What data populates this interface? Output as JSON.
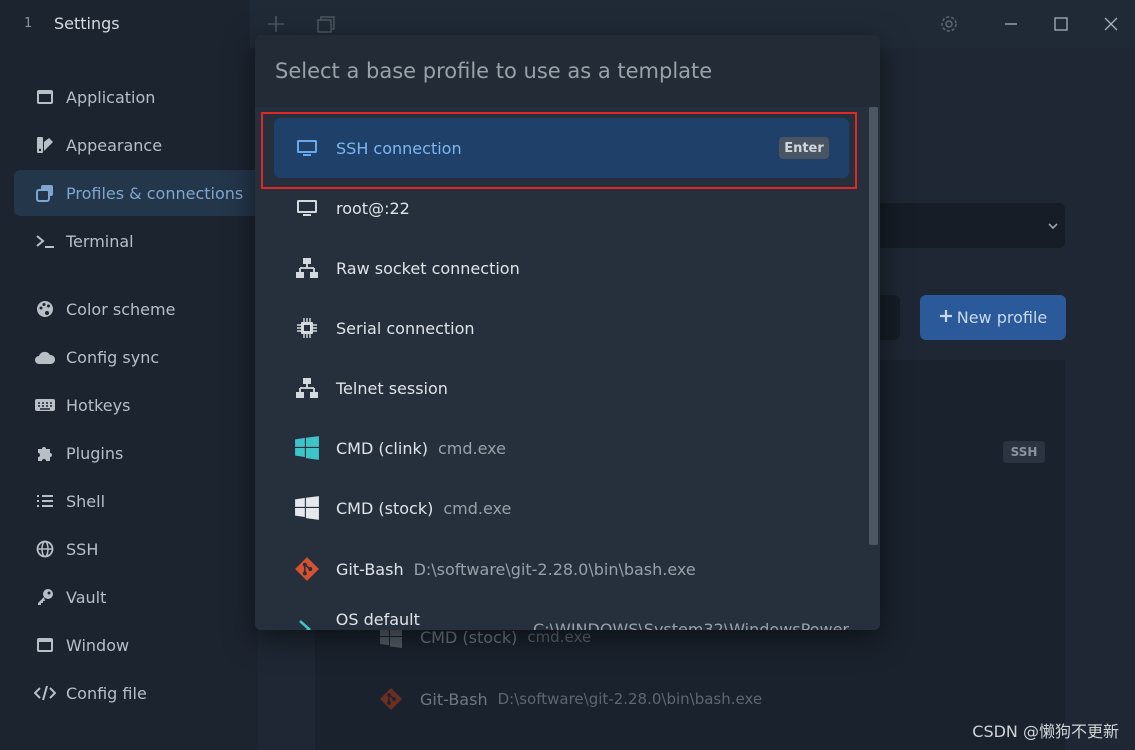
{
  "window": {
    "tab_index": "1",
    "tab_title": "Settings"
  },
  "sidebar": {
    "items": [
      {
        "label": "Application",
        "icon": "window-icon"
      },
      {
        "label": "Appearance",
        "icon": "appearance-icon"
      },
      {
        "label": "Profiles & connections",
        "icon": "profiles-icon",
        "active": true
      },
      {
        "label": "Terminal",
        "icon": "terminal-icon"
      },
      {
        "label": "Color scheme",
        "icon": "palette-icon"
      },
      {
        "label": "Config sync",
        "icon": "cloud-icon"
      },
      {
        "label": "Hotkeys",
        "icon": "keyboard-icon"
      },
      {
        "label": "Plugins",
        "icon": "puzzle-icon"
      },
      {
        "label": "Shell",
        "icon": "list-icon"
      },
      {
        "label": "SSH",
        "icon": "globe-icon"
      },
      {
        "label": "Vault",
        "icon": "key-icon"
      },
      {
        "label": "Window",
        "icon": "window-icon"
      },
      {
        "label": "Config file",
        "icon": "code-icon"
      }
    ]
  },
  "content": {
    "new_profile_label": "New profile",
    "ssh_badge": "SSH",
    "background_rows": [
      {
        "label": "CMD (stock)",
        "sub": "cmd.exe",
        "icon": "windows-icon"
      },
      {
        "label": "Git-Bash",
        "sub": "D:\\software\\git-2.28.0\\bin\\bash.exe",
        "icon": "git-icon"
      }
    ]
  },
  "modal": {
    "placeholder": "Select a base profile to use as a template",
    "enter_badge": "Enter",
    "options": [
      {
        "label": "SSH connection",
        "sub": "",
        "icon": "monitor-icon",
        "selected": true
      },
      {
        "label": "root@:22",
        "sub": "",
        "icon": "monitor-icon"
      },
      {
        "label": "Raw socket connection",
        "sub": "",
        "icon": "network-icon"
      },
      {
        "label": "Serial connection",
        "sub": "",
        "icon": "chip-icon"
      },
      {
        "label": "Telnet session",
        "sub": "",
        "icon": "network-icon"
      },
      {
        "label": "CMD (clink)",
        "sub": "cmd.exe",
        "icon": "windows-icon",
        "color": "#3ec3c9"
      },
      {
        "label": "CMD (stock)",
        "sub": "cmd.exe",
        "icon": "windows-icon",
        "color": "#e6e9ec"
      },
      {
        "label": "Git-Bash",
        "sub": "D:\\software\\git-2.28.0\\bin\\bash.exe",
        "icon": "git-icon",
        "color": "#d5512f"
      },
      {
        "label": "OS default (PowerShell)",
        "sub": "C:\\WINDOWS\\System32\\WindowsPower",
        "icon": "powershell-icon",
        "color": "#3ec3c9"
      }
    ]
  },
  "watermark": "CSDN @懒狗不更新",
  "colors": {
    "accent": "#1f4068",
    "accent_text": "#7fb6f0",
    "highlight_border": "#e02828",
    "button_primary": "#2a5a9a"
  }
}
